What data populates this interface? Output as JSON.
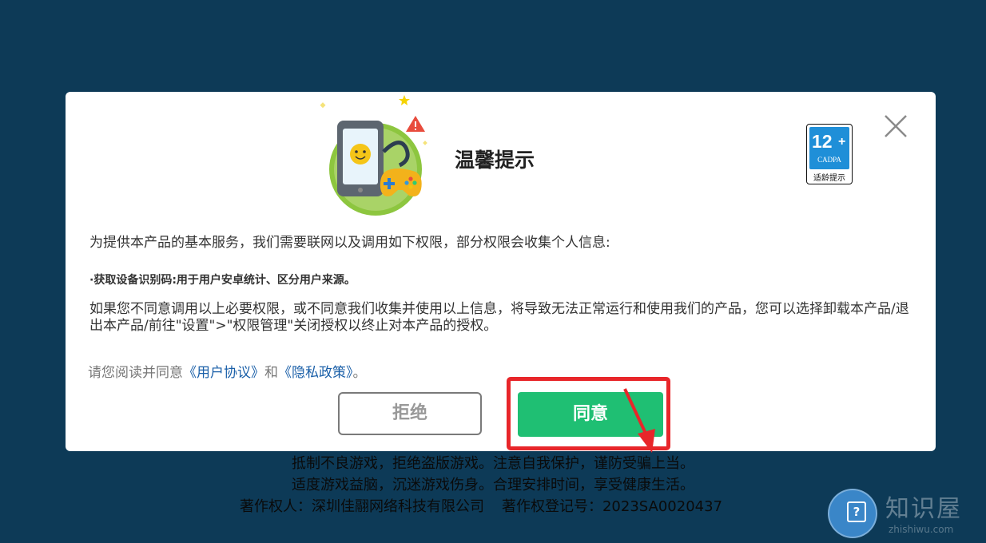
{
  "dialog": {
    "title": "温馨提示",
    "age_badge": {
      "number": "12",
      "plus": "+",
      "org": "CADPA",
      "tip": "适龄提示"
    },
    "close_symbol": "×",
    "intro": "为提供本产品的基本服务，我们需要联网以及调用如下权限，部分权限会收集个人信息:",
    "permission_item": "·获取设备识别码:用于用户安卓统计、区分用户来源。",
    "warning": "如果您不同意调用以上必要权限，或不同意我们收集并使用以上信息，将导致无法正常运行和使用我们的产品，您可以选择卸载本产品/退出本产品/前往\"设置\">\"权限管理\"关闭授权以终止对本产品的授权。",
    "consent": {
      "prefix": "请您阅读并同意",
      "user_agreement": "《用户协议》",
      "and": "和",
      "privacy_policy": "《隐私政策》",
      "suffix": "。"
    },
    "refuse_label": "拒绝",
    "agree_label": "同意"
  },
  "footer": {
    "line1": "抵制不良游戏，拒绝盗版游戏。注意自我保护，谨防受骗上当。",
    "line2": "适度游戏益脑，沉迷游戏伤身。合理安排时间，享受健康生活。",
    "copyright_holder": "著作权人：深圳佳翮网络科技有限公司",
    "registration": "著作权登记号：2023SA0020437"
  },
  "watermark": {
    "brand": "知识屋",
    "domain": "zhishiwu.com"
  },
  "colors": {
    "background": "#0d3a57",
    "agree_button": "#1fbf73",
    "highlight": "#e8262a",
    "link": "#1a5fa8",
    "badge_blue": "#1f8fd8"
  }
}
